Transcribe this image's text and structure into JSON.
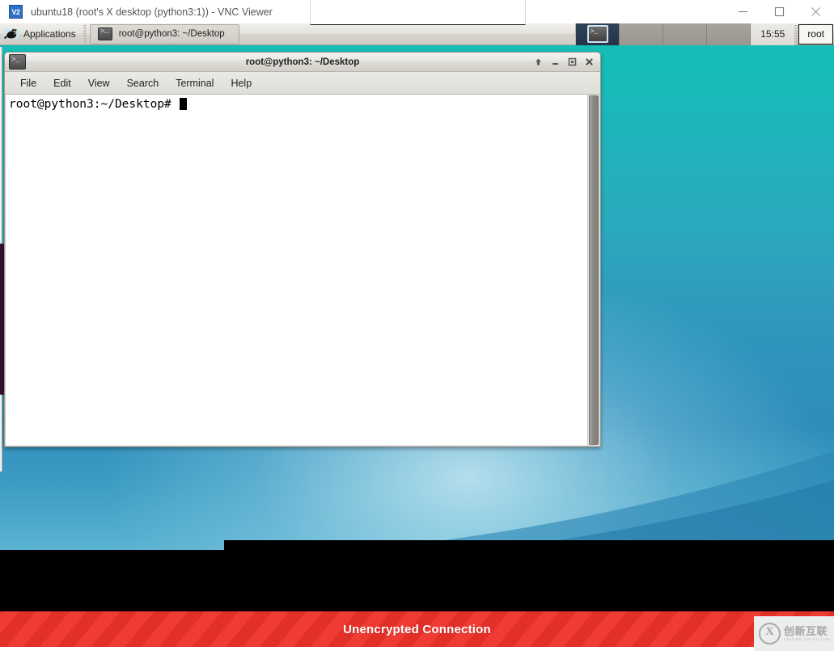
{
  "vnc_window": {
    "app_icon_label": "V2",
    "title": "ubuntu18 (root's X desktop (python3:1)) - VNC Viewer",
    "controls": {
      "minimize": "–",
      "maximize": "□",
      "close": "✕"
    }
  },
  "panel": {
    "applications_label": "Applications",
    "task_button": {
      "label": "root@python3: ~/Desktop",
      "icon": "terminal-icon"
    },
    "workspaces": [
      {
        "name": "workspace-1",
        "active": true,
        "icon": "terminal-icon"
      },
      {
        "name": "workspace-2",
        "active": false,
        "icon": ""
      },
      {
        "name": "workspace-3",
        "active": false,
        "icon": ""
      },
      {
        "name": "workspace-4",
        "active": false,
        "icon": ""
      }
    ],
    "clock": "15:55",
    "user": "root"
  },
  "terminal": {
    "title": "root@python3: ~/Desktop",
    "icon": "terminal-icon",
    "window_buttons": {
      "shade": "⬆",
      "minimize": "–",
      "maximize": "□",
      "close": "✕"
    },
    "menu": [
      {
        "label": "File"
      },
      {
        "label": "Edit"
      },
      {
        "label": "View"
      },
      {
        "label": "Search"
      },
      {
        "label": "Terminal"
      },
      {
        "label": "Help"
      }
    ],
    "prompt": "root@python3:~/Desktop# ",
    "content_lines": []
  },
  "banner": {
    "text": "Unencrypted Connection",
    "color": "#ef3b33"
  },
  "watermark": {
    "logo": "circled-x-logo",
    "chinese": "创新互联",
    "pinyin": "CHUANG XIN HU LIAN"
  },
  "colors": {
    "desktop_top": "#15bfb6",
    "desktop_bottom": "#2f8dbb",
    "panel": "#e4e2dd",
    "banner": "#ef3b33",
    "active_workspace": "#2e4155"
  }
}
